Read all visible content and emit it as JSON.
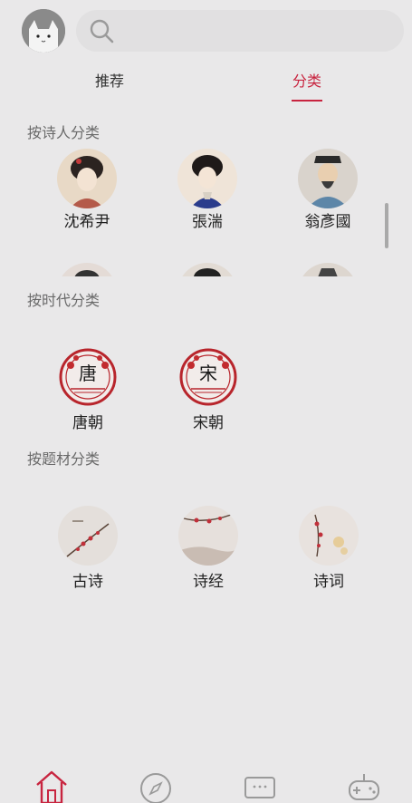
{
  "tabs": {
    "recommend": "推荐",
    "category": "分类"
  },
  "sections": {
    "by_poet": "按诗人分类",
    "by_era": "按时代分类",
    "by_topic": "按题材分类"
  },
  "poets": [
    {
      "name": "沈希尹"
    },
    {
      "name": "張湍"
    },
    {
      "name": "翁彥國"
    }
  ],
  "eras": [
    {
      "name": "唐朝",
      "seal": "唐"
    },
    {
      "name": "宋朝",
      "seal": "宋"
    }
  ],
  "topics": [
    {
      "name": "古诗"
    },
    {
      "name": "诗经"
    },
    {
      "name": "诗词"
    }
  ],
  "colors": {
    "accent": "#c8243f",
    "background": "#e9e8e9"
  },
  "bottom_nav": [
    "home-icon",
    "compass-icon",
    "chat-icon",
    "gamepad-icon"
  ]
}
